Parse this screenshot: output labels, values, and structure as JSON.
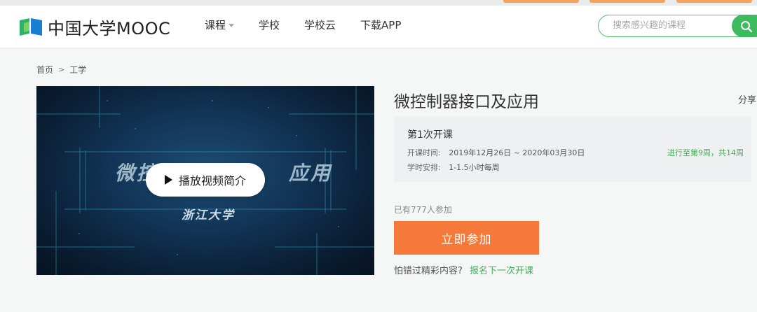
{
  "colors": {
    "brand_green": "#3dbb5f",
    "accent_orange": "#f5793b",
    "link_green": "#3fae53"
  },
  "header": {
    "logo_text": "中国大学MOOC",
    "logo_icon": "mooc-book-icon",
    "nav": [
      {
        "label": "课程",
        "has_dropdown": true
      },
      {
        "label": "学校",
        "has_dropdown": false
      },
      {
        "label": "学校云",
        "has_dropdown": false
      },
      {
        "label": "下载APP",
        "has_dropdown": false
      }
    ],
    "search": {
      "placeholder": "搜索感兴趣的课程",
      "icon": "search-icon"
    }
  },
  "breadcrumb": {
    "home": "首页",
    "separator": ">",
    "category": "工学"
  },
  "video": {
    "title_left": "微控",
    "title_right": "应用",
    "school": "浙江大学",
    "play_label": "播放视频简介"
  },
  "course": {
    "title": "微控制器接口及应用",
    "share_label": "分享",
    "term": {
      "title": "第1次开课",
      "time_label": "开课时间:",
      "time_value": "2019年12月26日 ~ 2020年03月30日",
      "schedule_label": "学时安排:",
      "schedule_value": "1-1.5小时每周",
      "progress": "进行至第9周，共14周"
    },
    "enrolled": "已有777人参加",
    "join_label": "立即参加",
    "miss_text": "怕错过精彩内容?",
    "next_term_link": "报名下一次开课"
  }
}
